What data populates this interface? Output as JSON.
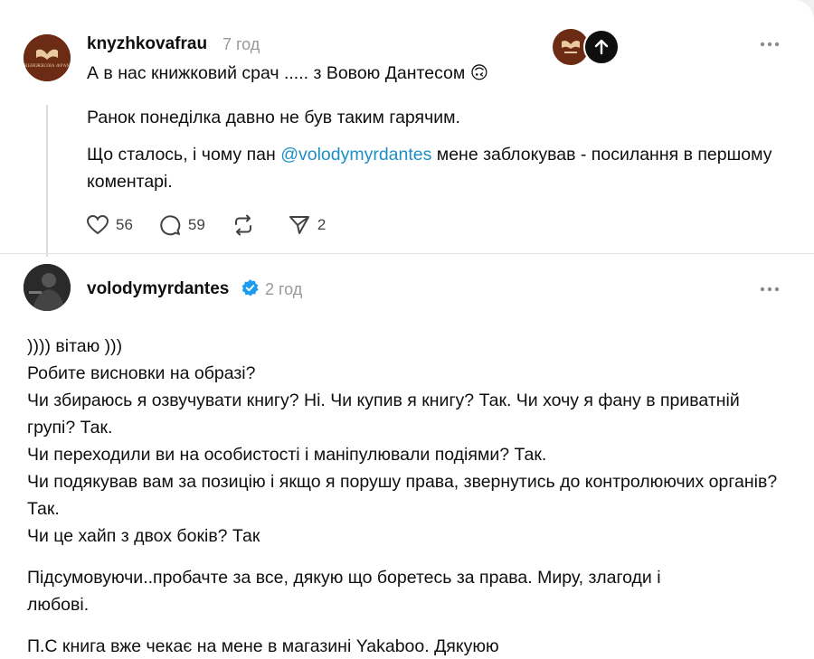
{
  "post": {
    "username": "knyzhkovafrau",
    "time": "7 год",
    "headline": "А в нас книжковий срач ..... з Вовою Дантесом",
    "emoji": "🙃",
    "para1": "Ранок понеділка давно не був таким гарячим.",
    "para2_before": "Що сталось, і чому пан ",
    "para2_mention": "@volodymyrdantes",
    "para2_after": " мене заблокував - посилання в першому коментарі.",
    "likes": "56",
    "comments": "59",
    "shares": "2",
    "logo_text": "КНИЖКОВА ФРАУ"
  },
  "reply": {
    "username": "volodymyrdantes",
    "time": "2 год",
    "lines": [
      ")))) вітаю )))",
      "Робите висновки на образі?",
      "Чи збираюсь я озвучувати книгу? Ні. Чи купив я книгу? Так. Чи хочу я фану в приватній групі? Так.",
      "Чи переходили ви на особистості і маніпулювали подіями? Так.",
      "Чи подякував вам за позицію і якщо я порушу права, звернутись до контролюючих органів? Так.",
      "Чи це хайп з двох боків? Так"
    ],
    "summary": "Підсумовуючи..пробачте за все, дякую що боретесь за права. Миру, злагоди і любові.",
    "ps": "П.С книга вже чекає на мене в магазині Yakaboo. Дякуюю"
  },
  "icons": {
    "like": "heart-icon",
    "comment": "comment-icon",
    "repost": "repost-icon",
    "share": "send-icon",
    "more": "more-horizontal-icon",
    "verified": "verified-badge-icon",
    "scroll_top": "arrow-up-icon"
  },
  "colors": {
    "mention": "#1e8fc4",
    "verified": "#1d9bf0",
    "avatar_brand": "#6b2b14"
  }
}
